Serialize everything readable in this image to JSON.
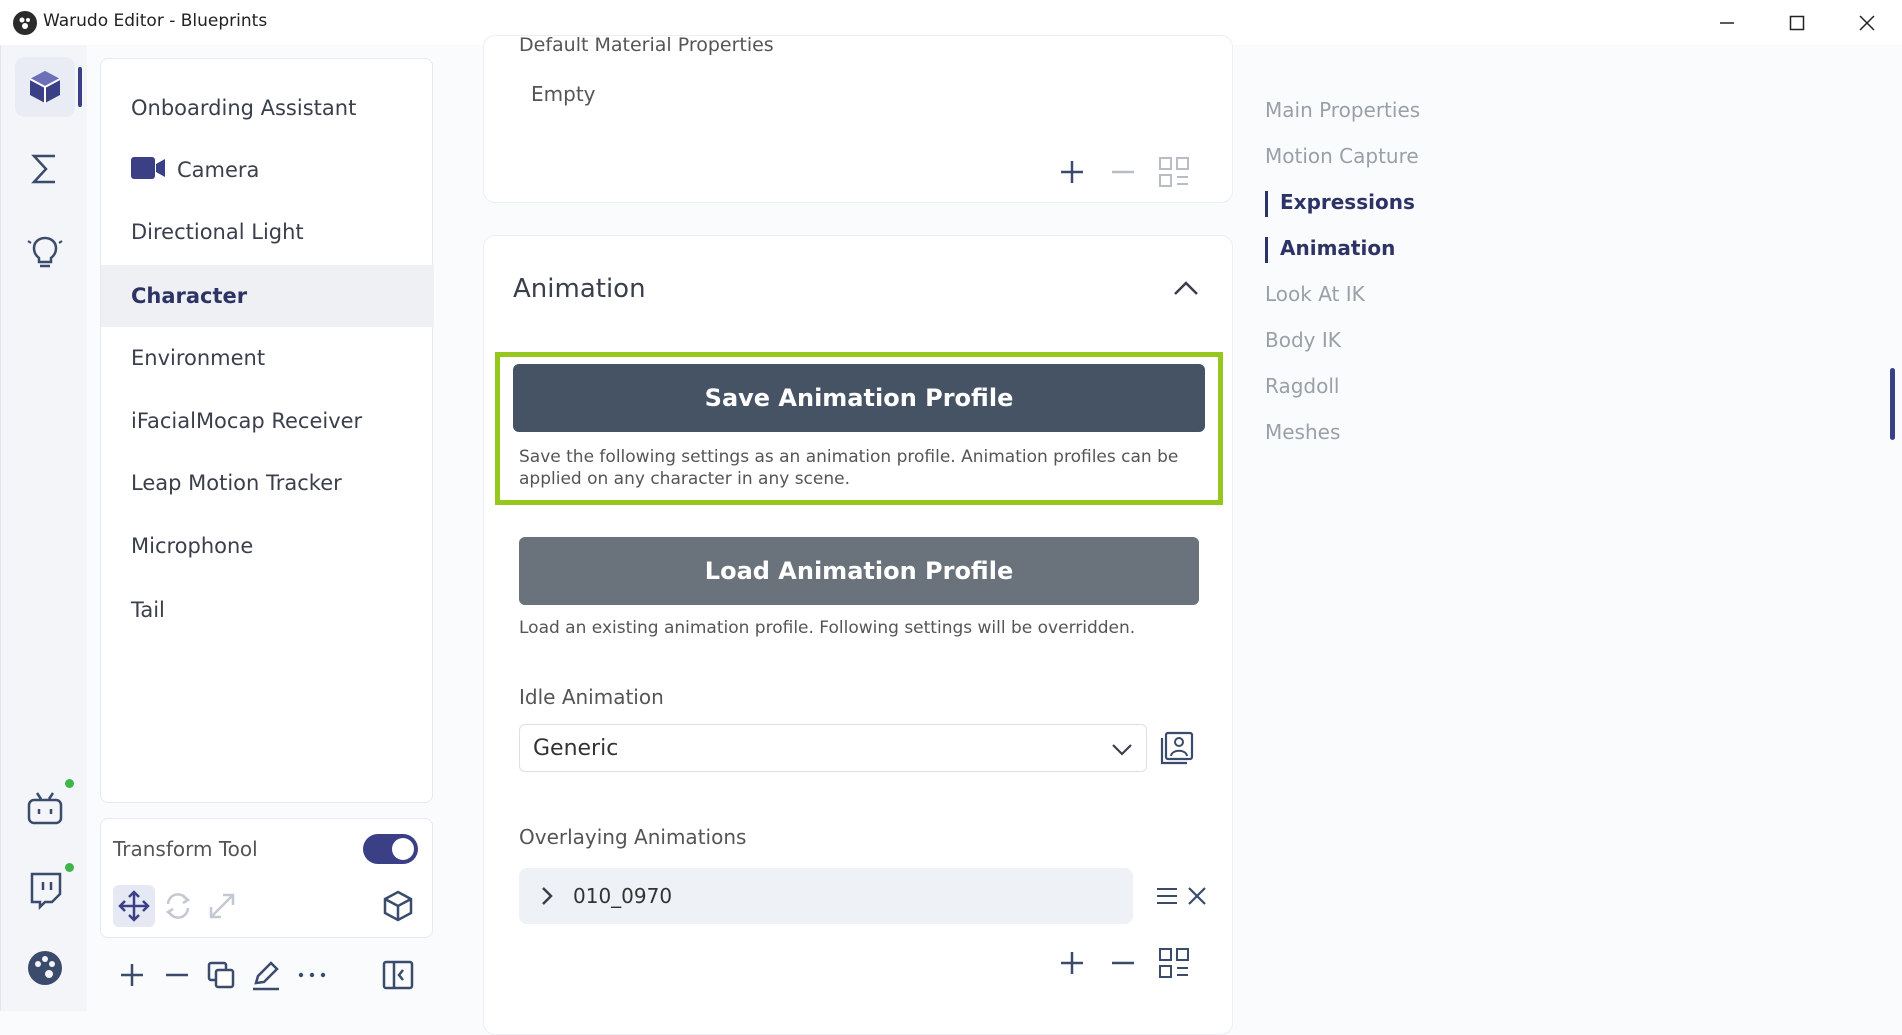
{
  "window": {
    "title": "Warudo Editor - Blueprints"
  },
  "nav": {
    "items": [
      {
        "label": "Onboarding Assistant"
      },
      {
        "label": "Camera"
      },
      {
        "label": "Directional Light"
      },
      {
        "label": "Character"
      },
      {
        "label": "Environment"
      },
      {
        "label": "iFacialMocap Receiver"
      },
      {
        "label": "Leap Motion Tracker"
      },
      {
        "label": "Microphone"
      },
      {
        "label": "Tail"
      }
    ],
    "selected": "Character"
  },
  "tools": {
    "transform_label": "Transform Tool",
    "transform_enabled": true
  },
  "main": {
    "cut_heading": "Default Material Properties",
    "empty_label": "Empty",
    "animation": {
      "title": "Animation",
      "save_button": "Save Animation Profile",
      "save_desc": "Save the following settings as an animation profile. Animation profiles can be applied on any character in any scene.",
      "load_button": "Load Animation Profile",
      "load_desc": "Load an existing animation profile. Following settings will be overridden.",
      "idle_label": "Idle Animation",
      "idle_value": "Generic",
      "overlay_label": "Overlaying Animations",
      "overlay_items": [
        {
          "label": "010_0970"
        }
      ]
    }
  },
  "toc": {
    "items": [
      {
        "label": "Main Properties",
        "active": false
      },
      {
        "label": "Motion Capture",
        "active": false
      },
      {
        "label": "Expressions",
        "active": true
      },
      {
        "label": "Animation",
        "active": true
      },
      {
        "label": "Look At IK",
        "active": false
      },
      {
        "label": "Body IK",
        "active": false
      },
      {
        "label": "Ragdoll",
        "active": false
      },
      {
        "label": "Meshes",
        "active": false
      }
    ]
  },
  "colors": {
    "accent": "#3b3f86",
    "highlight": "#96c71d",
    "primary_button": "#465365",
    "secondary_button": "#6a737c",
    "status_online": "#3cb64a"
  }
}
